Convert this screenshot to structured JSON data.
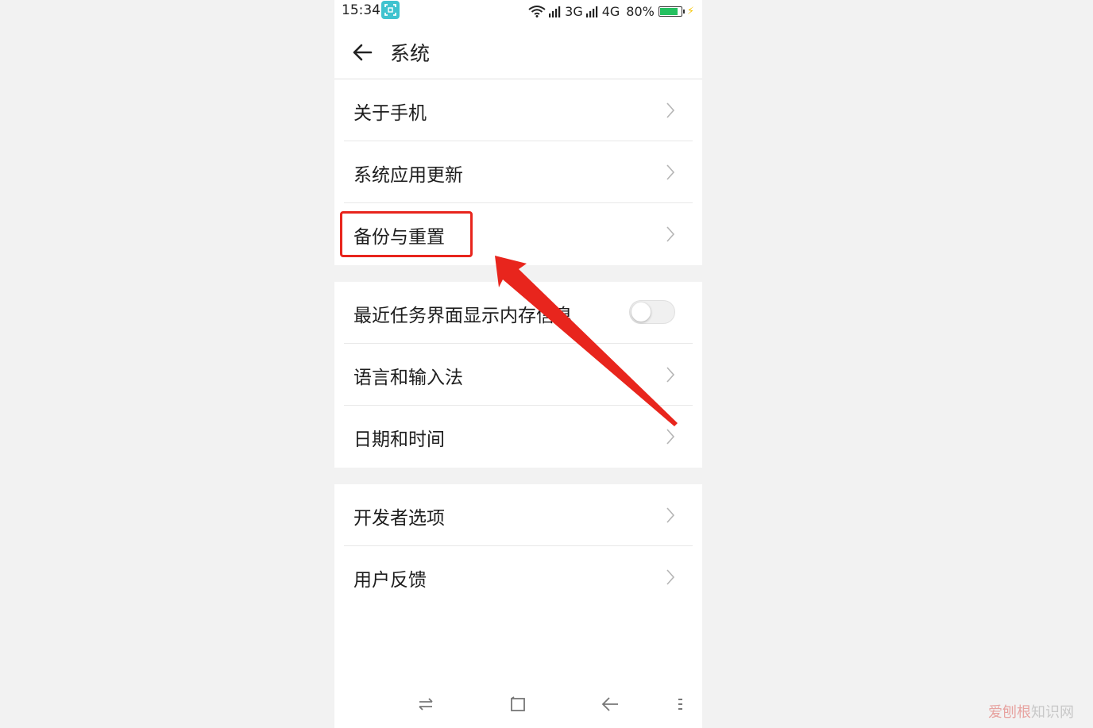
{
  "status_bar": {
    "time": "15:34",
    "network1": "3G",
    "network2": "4G",
    "battery": "80%",
    "battery_level": 0.8,
    "icons": [
      "screen-capture-icon",
      "wifi-icon",
      "signal-icon",
      "battery-icon",
      "charging-icon"
    ]
  },
  "header": {
    "title": "系统",
    "back_icon": "arrow-left-icon"
  },
  "settings": {
    "group1": [
      {
        "label": "关于手机"
      },
      {
        "label": "系统应用更新"
      },
      {
        "label": "备份与重置"
      }
    ],
    "group2": [
      {
        "label": "最近任务界面显示内存信息",
        "toggle": false
      },
      {
        "label": "语言和输入法"
      },
      {
        "label": "日期和时间"
      }
    ],
    "group3": [
      {
        "label": "开发者选项"
      },
      {
        "label": "用户反馈"
      }
    ]
  },
  "annotation": {
    "highlight_color": "#e8251d",
    "arrow_color": "#e8251d"
  },
  "navbar": {
    "icons": [
      "switch-icon",
      "home-square-icon",
      "back-icon",
      "menu-icon"
    ]
  },
  "watermark": {
    "red_part": "爱刨根",
    "gray_part": "知识网"
  },
  "colors": {
    "background": "#f2f2f2",
    "toggle_off": "#f0f0f0",
    "battery_fill": "#25c060",
    "accent_app_icon": "#3fc3cf"
  }
}
